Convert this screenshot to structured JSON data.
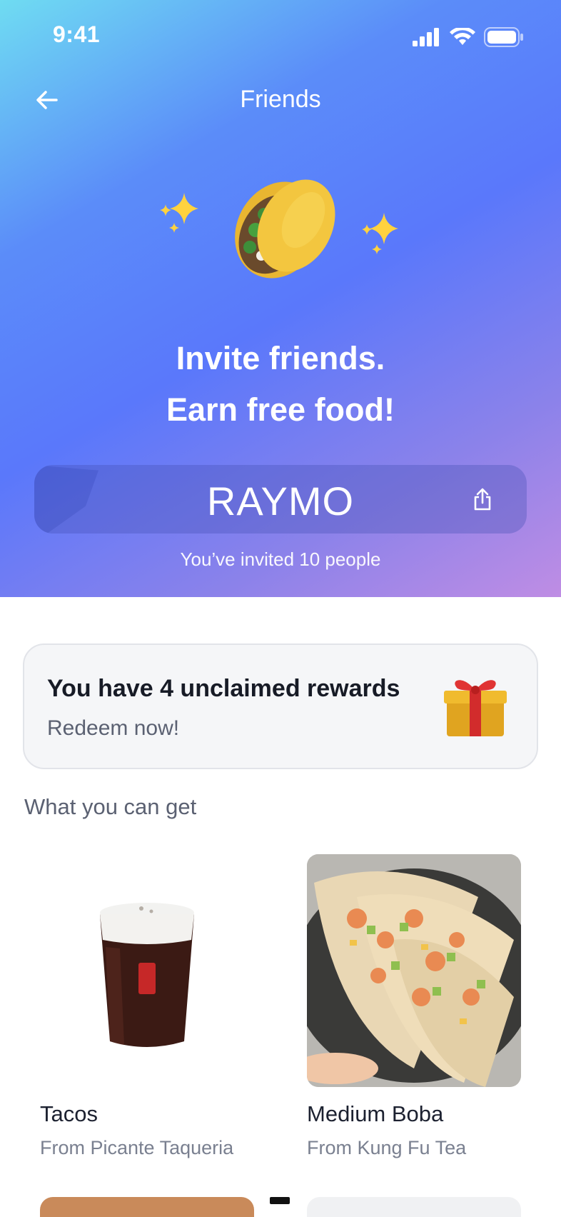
{
  "status_bar": {
    "time": "9:41",
    "icons": [
      "signal-icon",
      "wifi-icon",
      "battery-icon"
    ]
  },
  "nav": {
    "title": "Friends",
    "back_icon": "arrow-left-icon"
  },
  "hero": {
    "headline_line1": "Invite friends.",
    "headline_line2": "Earn free food!",
    "art_icons": [
      "sparkles-icon",
      "taco-icon",
      "sparkles-icon"
    ]
  },
  "referral": {
    "code": "RAYMO",
    "share_icon": "share-icon",
    "invited_text": "You’ve invited 10 people"
  },
  "rewards": {
    "title": "You have 4 unclaimed rewards",
    "subtitle": "Redeem now!",
    "icon": "gift-icon"
  },
  "catalog": {
    "section_title": "What you can get",
    "items": [
      {
        "name": "Tacos",
        "source": "From Picante Taqueria",
        "image": "boba-cup-image"
      },
      {
        "name": "Medium Boba",
        "source": "From Kung Fu Tea",
        "image": "tacos-plate-image"
      }
    ]
  },
  "colors": {
    "gradient_start": "#6fdcf2",
    "gradient_mid": "#5a78fb",
    "gradient_end": "#bf8de4",
    "card_bg": "#f5f6f8",
    "text_primary": "#1c2130",
    "text_secondary": "#5b6172"
  }
}
